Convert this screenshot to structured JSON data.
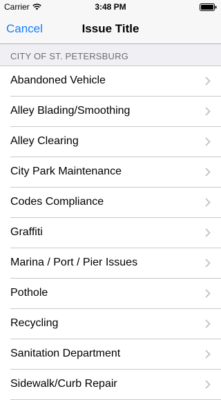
{
  "status_bar": {
    "carrier": "Carrier",
    "time": "3:48 PM"
  },
  "nav": {
    "cancel_label": "Cancel",
    "title": "Issue Title"
  },
  "section": {
    "header": "CITY OF ST. PETERSBURG"
  },
  "items": [
    {
      "label": "Abandoned Vehicle"
    },
    {
      "label": "Alley Blading/Smoothing"
    },
    {
      "label": "Alley Clearing"
    },
    {
      "label": "City Park Maintenance"
    },
    {
      "label": "Codes Compliance"
    },
    {
      "label": "Graffiti"
    },
    {
      "label": "Marina / Port / Pier Issues"
    },
    {
      "label": "Pothole"
    },
    {
      "label": "Recycling"
    },
    {
      "label": "Sanitation Department"
    },
    {
      "label": "Sidewalk/Curb Repair"
    }
  ],
  "colors": {
    "accent": "#157efb",
    "section_bg": "#efeff4",
    "section_text": "#6d6d72",
    "separator": "#c8c7cc",
    "chevron": "#c7c7cc"
  },
  "icons": {
    "wifi": "wifi-icon",
    "battery": "battery-icon",
    "chevron": "chevron-right-icon"
  }
}
